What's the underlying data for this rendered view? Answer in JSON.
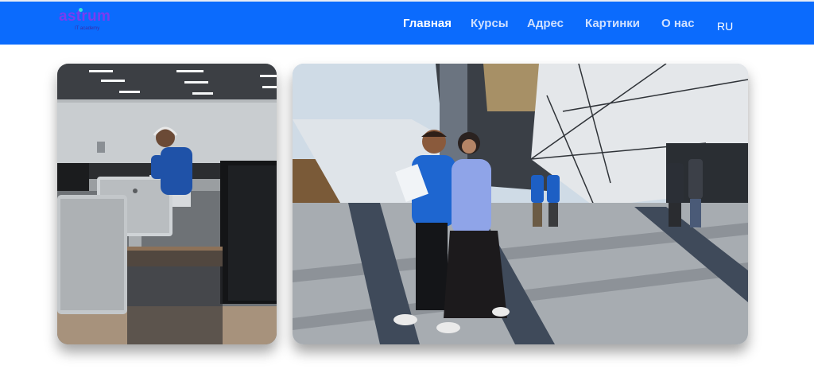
{
  "brand": {
    "name": "astrum",
    "tagline": "IT academy",
    "colors": {
      "wordmark": "#7a3cf0",
      "dot": "#35e0d8"
    }
  },
  "nav": {
    "background": "#0b6bfd",
    "items": [
      {
        "label": "Главная",
        "active": true
      },
      {
        "label": "Курсы",
        "active": false
      },
      {
        "label": "Адрес",
        "active": false
      },
      {
        "label": "Картинки",
        "active": false
      },
      {
        "label": "О нас",
        "active": false
      }
    ],
    "language": "RU"
  },
  "gallery": {
    "images": [
      {
        "name": "computer-lab-photo"
      },
      {
        "name": "campus-students-photo"
      }
    ]
  }
}
